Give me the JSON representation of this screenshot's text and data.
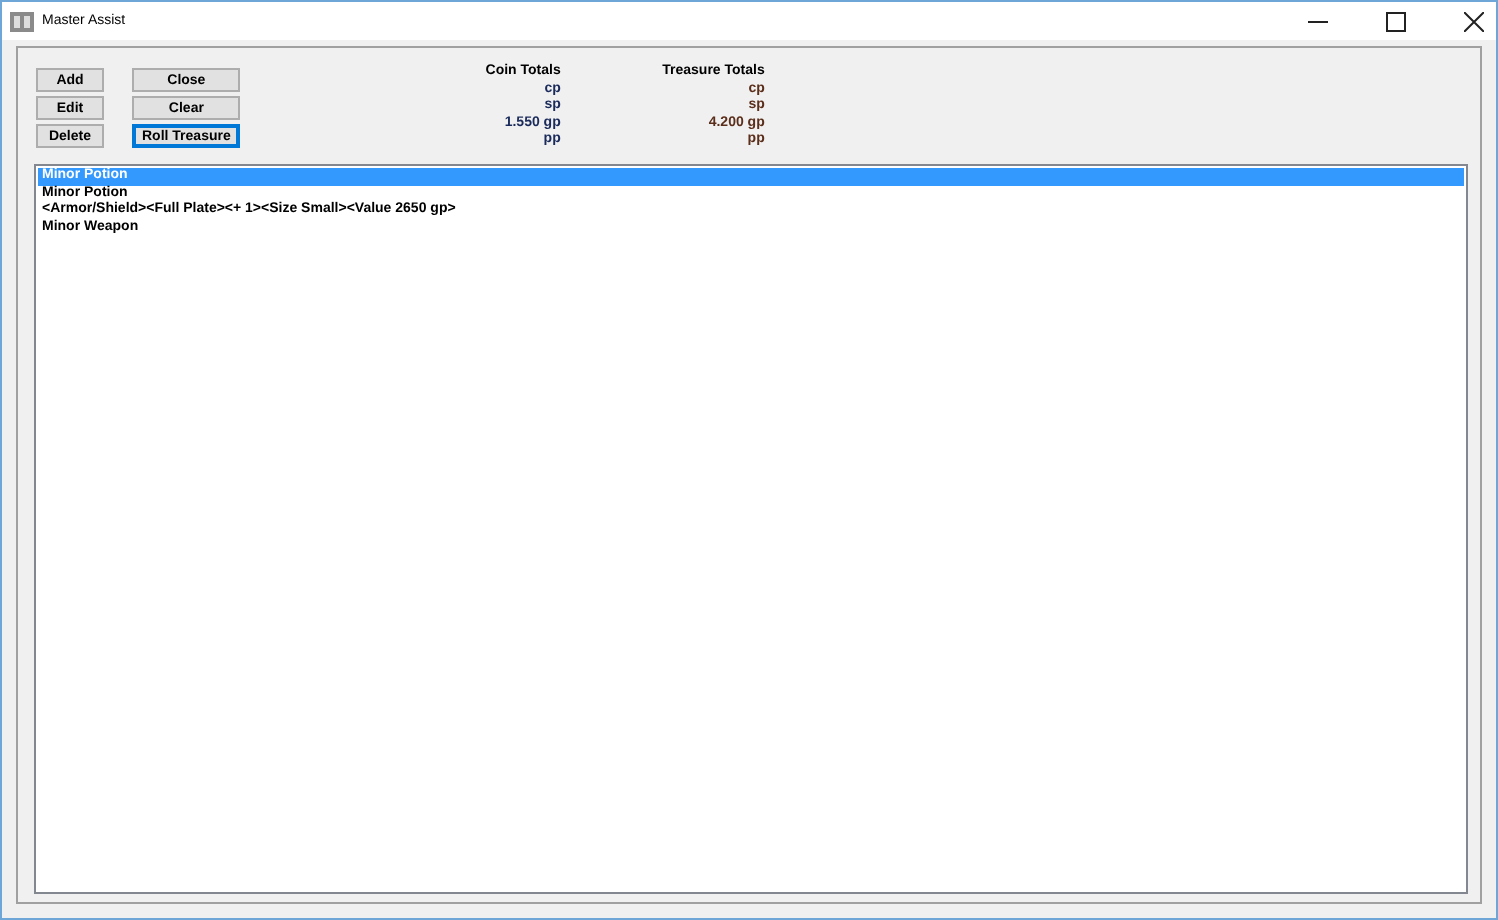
{
  "window": {
    "title": "Master Assist"
  },
  "buttons": [
    {
      "label": "Add",
      "focused": false
    },
    {
      "label": "Edit",
      "focused": false
    },
    {
      "label": "Delete",
      "focused": false
    },
    {
      "label": "Close",
      "focused": false
    },
    {
      "label": "Clear",
      "focused": false
    },
    {
      "label": "Roll Treasure",
      "focused": true
    }
  ],
  "coin_totals": {
    "heading": "Coin Totals",
    "lines": [
      "cp",
      "sp",
      "1.550 gp",
      "pp"
    ]
  },
  "treasure_totals": {
    "heading": "Treasure Totals",
    "lines": [
      "cp",
      "sp",
      "4.200 gp",
      "pp"
    ]
  },
  "items": [
    {
      "label": "Minor Potion",
      "selected": true
    },
    {
      "label": "Minor Potion",
      "selected": false
    },
    {
      "label": "<Armor/Shield><Full Plate><+ 1><Size Small><Value 2650 gp>",
      "selected": false
    },
    {
      "label": "Minor Weapon",
      "selected": false
    }
  ]
}
